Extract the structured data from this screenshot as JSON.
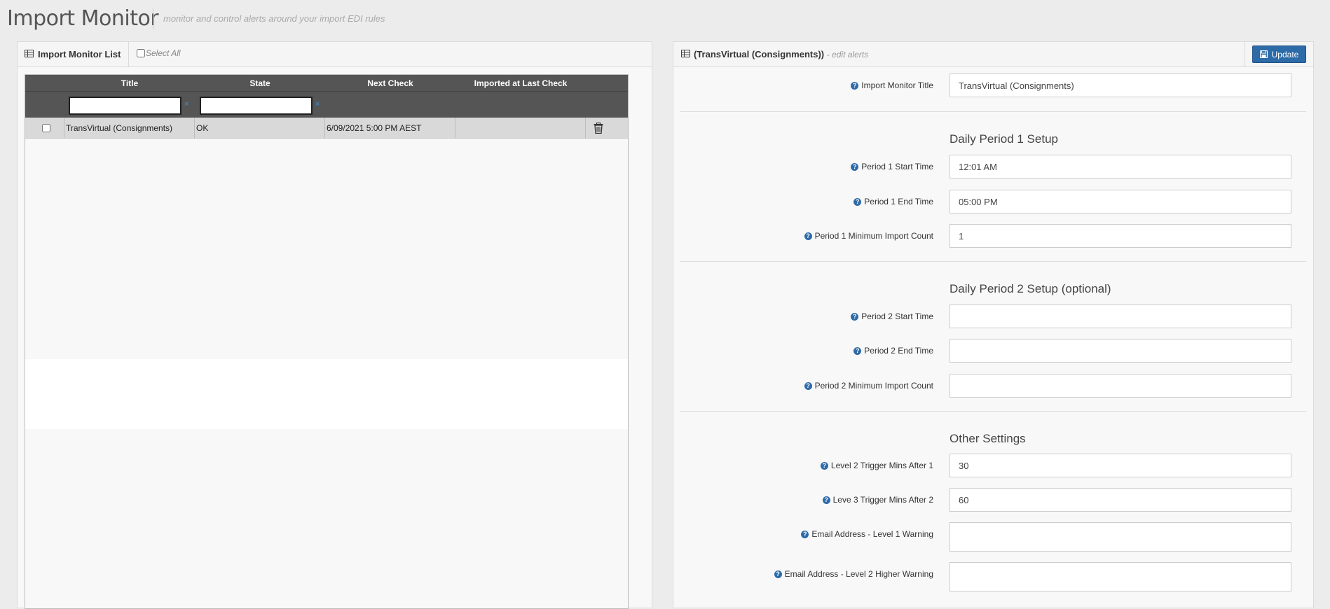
{
  "page": {
    "title": "Import Monitor",
    "subtitle": "monitor and control alerts around your import EDI rules"
  },
  "list_panel": {
    "title": "Import Monitor List",
    "select_all_label": "Select All",
    "columns": [
      "Title",
      "State",
      "Next Check",
      "Imported at Last Check"
    ],
    "filter_clear_glyph": "×",
    "rows": [
      {
        "title": "TransVirtual (Consignments)",
        "state": "OK",
        "next_check": "6/09/2021 5:00 PM AEST",
        "imported_at_last_check": ""
      }
    ]
  },
  "edit_panel": {
    "title": "(TransVirtual (Consignments))",
    "subtitle": "- edit alerts",
    "update_label": "Update",
    "monitor_title_label": "Import Monitor Title",
    "monitor_title_value": "TransVirtual (Consignments)",
    "section1": {
      "title": "Daily Period 1 Setup",
      "start_label": "Period 1 Start Time",
      "start_value": "12:01 AM",
      "end_label": "Period 1 End Time",
      "end_value": "05:00 PM",
      "min_label": "Period 1 Minimum Import Count",
      "min_value": "1"
    },
    "section2": {
      "title": "Daily Period 2 Setup (optional)",
      "start_label": "Period 2 Start Time",
      "start_value": "",
      "end_label": "Period 2 End Time",
      "end_value": "",
      "min_label": "Period 2 Minimum Import Count",
      "min_value": ""
    },
    "section3": {
      "title": "Other Settings",
      "level2_label": "Level 2 Trigger Mins After 1",
      "level2_value": "30",
      "level3_label": "Leve 3 Trigger Mins After 2",
      "level3_value": "60",
      "email1_label": "Email Address - Level 1 Warning",
      "email1_value": "",
      "email2_label": "Email Address - Level 2 Higher Warning",
      "email2_value": ""
    }
  },
  "icons": {
    "help": "?",
    "grid": "grid-icon",
    "save": "save-icon",
    "trash": "trash-icon"
  },
  "colors": {
    "accent": "#2d6aa8",
    "grid_header": "#555555",
    "row_bg": "#d9d9d9"
  }
}
